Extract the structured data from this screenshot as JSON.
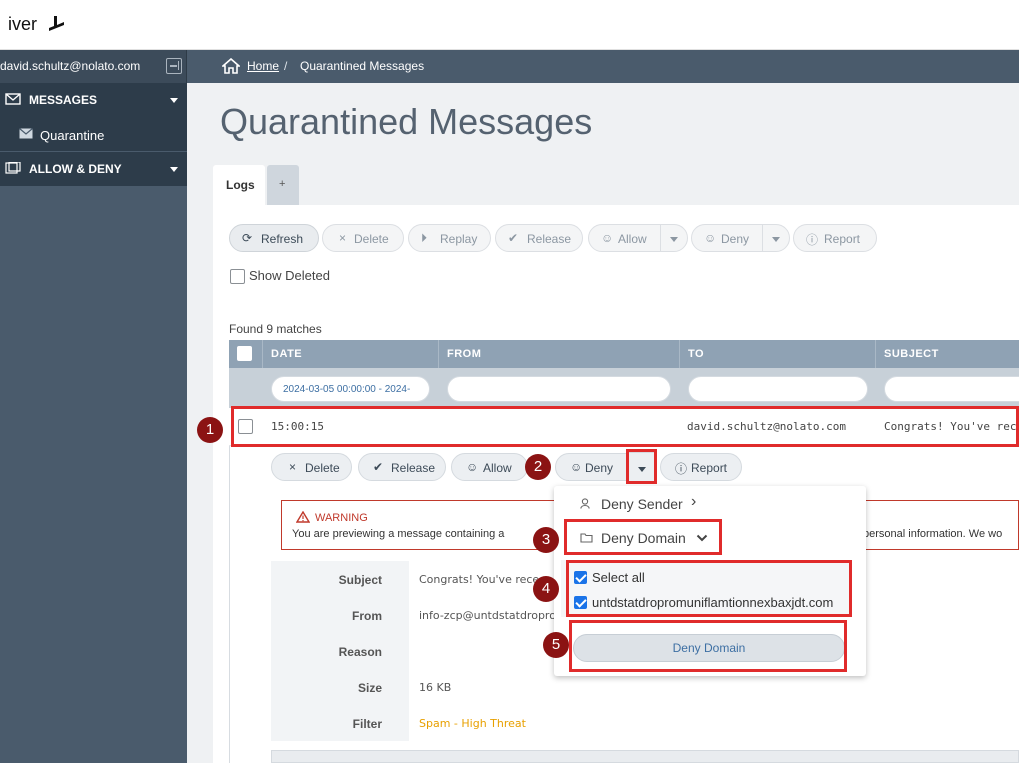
{
  "brand": {
    "logo_text": "iver"
  },
  "header": {
    "user_email": "david.schultz@nolato.com",
    "breadcrumb": {
      "home": "Home",
      "separator": "/",
      "current": "Quarantined Messages"
    }
  },
  "sidebar": {
    "sections": [
      {
        "label": "MESSAGES",
        "items": [
          {
            "label": "Quarantine"
          }
        ]
      },
      {
        "label": "ALLOW & DENY"
      }
    ]
  },
  "page": {
    "title": "Quarantined Messages",
    "tabs": [
      {
        "label": "Logs"
      },
      {
        "label": "+"
      }
    ]
  },
  "toolbar": {
    "refresh": "Refresh",
    "delete": "Delete",
    "replay": "Replay",
    "release": "Release",
    "allow": "Allow",
    "deny": "Deny",
    "report": "Report"
  },
  "show_deleted_label": "Show Deleted",
  "found_text": "Found 9 matches",
  "table": {
    "columns": [
      "DATE",
      "FROM",
      "TO",
      "SUBJECT"
    ],
    "date_filter": "2024-03-05 00:00:00 - 2024-",
    "rows": [
      {
        "date": "15:00:15",
        "from": "",
        "to": "david.schultz@nolato.com",
        "subject": "Congrats! You've receive"
      }
    ]
  },
  "row_actions": {
    "delete": "Delete",
    "release": "Release",
    "allow": "Allow",
    "deny": "Deny",
    "report": "Report"
  },
  "warning": {
    "title": "WARNING",
    "text_left": "You are previewing a message containing a",
    "text_right": "personal information. We wo"
  },
  "details": {
    "subject_label": "Subject",
    "subject_value": "Congrats! You've rece",
    "from_label": "From",
    "from_value": "info-zcp@untdstatdropro",
    "reason_label": "Reason",
    "reason_value": "",
    "size_label": "Size",
    "size_value": "16 KB",
    "filter_label": "Filter",
    "filter_value": "Spam - High Threat"
  },
  "dropdown": {
    "deny_sender": "Deny Sender",
    "deny_domain": "Deny Domain",
    "select_all": "Select all",
    "domain": "untdstatdropromuniflamtionnexbaxjdt.com",
    "deny_domain_button": "Deny Domain"
  },
  "annotations": [
    "1",
    "2",
    "3",
    "4",
    "5"
  ],
  "colors": {
    "sidebar_bg": "#4a5b6c",
    "section_bg": "#2d3c4a",
    "warning": "#c0392b",
    "highlight": "#e02b2b",
    "marker": "#8b1313",
    "spam": "#e8a000"
  }
}
